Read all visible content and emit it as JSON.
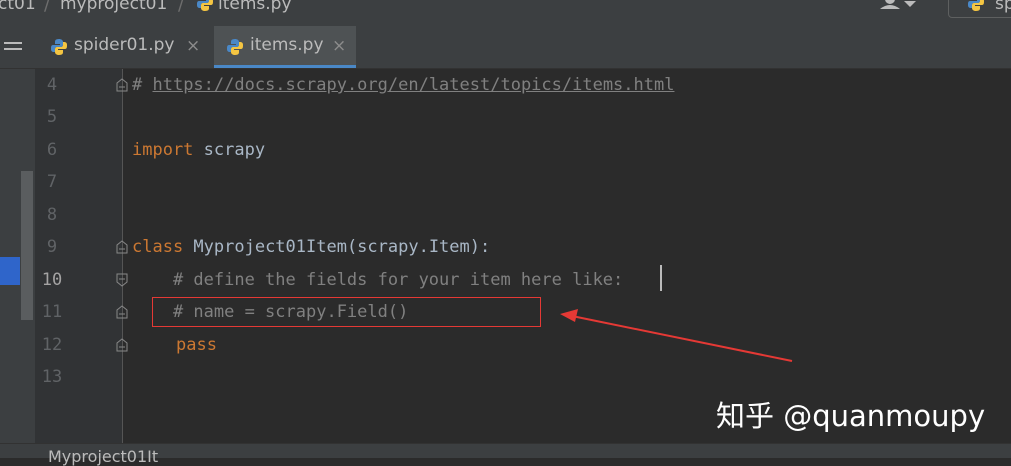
{
  "navbar": {
    "crumbs": [
      "ct01",
      "myproject01",
      "items.py"
    ],
    "separator": "/",
    "run_config_label": "sp"
  },
  "tabs": [
    {
      "label": "spider01.py",
      "close": "×",
      "active": false
    },
    {
      "label": "items.py",
      "close": "×",
      "active": true
    }
  ],
  "editor": {
    "current_line": "10",
    "lines": [
      {
        "number": "4",
        "text": "# https://docs.scrapy.org/en/latest/topics/items.html"
      },
      {
        "number": "5",
        "text": ""
      },
      {
        "number": "6",
        "kw": "import",
        "text": " scrapy"
      },
      {
        "number": "7",
        "text": ""
      },
      {
        "number": "8",
        "text": ""
      },
      {
        "number": "9",
        "kw": "class",
        "text": " Myproject01Item(scrapy.Item):"
      },
      {
        "number": "10",
        "text": "    # define the fields for your item here like:"
      },
      {
        "number": "11",
        "text": "    # name = scrapy.Field()"
      },
      {
        "number": "12",
        "kw": "pass"
      },
      {
        "number": "13",
        "text": ""
      }
    ],
    "url_comment_prefix": "# ",
    "url": "https://docs.scrapy.org/en/latest/topics/items.html"
  },
  "annotation": {
    "color": "#e53935"
  },
  "watermark": "知乎 @quanmoupy",
  "statusbar": {
    "text": "Myproject01It"
  },
  "colors": {
    "keyword": "#cc7832",
    "comment": "#808080",
    "code": "#a9b7c6",
    "accent": "#4a88c7"
  }
}
